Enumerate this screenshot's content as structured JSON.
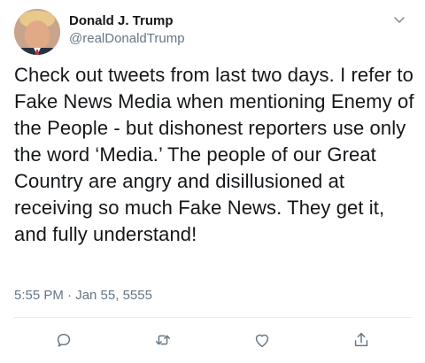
{
  "tweet": {
    "display_name": "Donald J. Trump",
    "handle": "@realDonaldTrump",
    "text": "Check out tweets from last two days. I refer to Fake News Media when mentioning Enemy of the People - but dishonest reporters use only the word ‘Media.’ The people of our Great Country are angry and disillusioned at receiving so much Fake News. They get it, and fully understand!",
    "timestamp": "5:55 PM · Jan 55, 5555"
  },
  "icons": {
    "caret": "chevron-down-icon",
    "reply": "reply-icon",
    "retweet": "retweet-icon",
    "like": "heart-icon",
    "share": "share-icon"
  },
  "colors": {
    "text": "#14171a",
    "secondary": "#657786",
    "divider": "#e6ecf0"
  }
}
